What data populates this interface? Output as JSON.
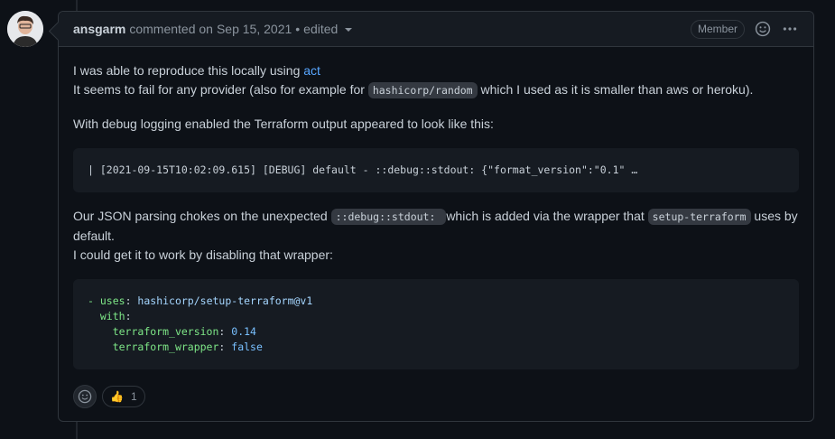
{
  "comment": {
    "author": "ansgarm",
    "action": "commented on",
    "date": "Sep 15, 2021",
    "separator": "•",
    "edited": "edited",
    "role_badge": "Member"
  },
  "body": {
    "p1_line1_text": "I was able to reproduce this locally using ",
    "p1_link": "act",
    "p1_line2_pre": "It seems to fail for any provider (also for example for ",
    "p1_code": "hashicorp/random",
    "p1_line2_post": " which I used as it is smaller than aws or heroku).",
    "p2": "With debug logging enabled the Terraform output appeared to look like this:",
    "code1": "| [2021-09-15T10:02:09.615] [DEBUG] default - ::debug::stdout: {\"format_version\":\"0.1\" …",
    "p3_pre": "Our JSON parsing chokes on the unexpected ",
    "p3_code1": "::debug::stdout: ",
    "p3_mid": " which is added via the wrapper that ",
    "p3_code2": "setup-terraform",
    "p3_post": " uses by default.",
    "p3_line2": "I could get it to work by disabling that wrapper:",
    "yaml": {
      "l1_dash": "- ",
      "l1_key": "uses",
      "l1_val": "hashicorp/setup-terraform@v1",
      "l2_key": "with",
      "l3_key": "terraform_version",
      "l3_val": "0.14",
      "l4_key": "terraform_wrapper",
      "l4_val": "false"
    }
  },
  "reactions": {
    "thumbs_up_count": "1",
    "thumbs_up_emoji": "👍"
  },
  "colors": {
    "link": "#58a6ff",
    "background": "#0d1117",
    "border": "#30363d"
  }
}
